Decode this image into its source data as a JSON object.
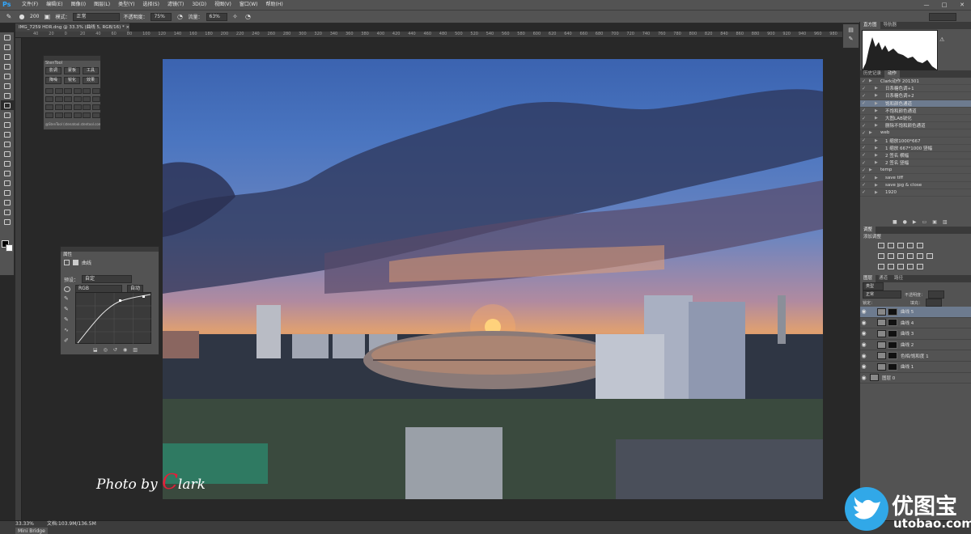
{
  "app": {
    "logo": "Ps"
  },
  "menubar": {
    "items": [
      "文件(F)",
      "编辑(E)",
      "图像(I)",
      "图层(L)",
      "类型(Y)",
      "选择(S)",
      "滤镜(T)",
      "3D(D)",
      "视图(V)",
      "窗口(W)",
      "帮助(H)"
    ],
    "window_controls": [
      "—",
      "□",
      "✕"
    ]
  },
  "options_bar": {
    "brush_size": "200",
    "mode_label": "模式：",
    "mode_value": "正常",
    "opacity_label": "不透明度：",
    "opacity_value": "75%",
    "flow_label": "流量：",
    "flow_value": "63%"
  },
  "document": {
    "tab_title": "IMG_7259 HDR.dng @ 33.3% (曲线 5, RGB/16) * ×",
    "ruler_ticks": [
      "40",
      "20",
      "0",
      "20",
      "40",
      "60",
      "80",
      "100",
      "120",
      "140",
      "160",
      "180",
      "200",
      "220",
      "240",
      "260",
      "280",
      "300",
      "320",
      "340",
      "360",
      "380",
      "400",
      "420",
      "440",
      "460",
      "480",
      "500",
      "520",
      "540",
      "560",
      "580",
      "600",
      "620",
      "640",
      "660",
      "680",
      "700",
      "720",
      "740",
      "760",
      "780",
      "800",
      "820",
      "840",
      "860",
      "880",
      "900",
      "920",
      "940",
      "960",
      "980",
      "1000"
    ]
  },
  "watermark": {
    "prefix": "Photo by ",
    "initial": "C",
    "rest": "lark"
  },
  "stn_panel": {
    "title": "StenTool",
    "buttons": [
      "影调",
      "蒙板",
      "工具",
      "降噪",
      "锐化",
      "效果"
    ],
    "footer": "@StenTool (stenatool.stentool.com)"
  },
  "properties_panel": {
    "tab": "属性",
    "title": "曲线",
    "preset_label": "预设：",
    "preset_value": "自定",
    "channel_value": "RGB",
    "auto_label": "自动"
  },
  "histogram_panel": {
    "tabs": [
      "直方图",
      "导航器"
    ]
  },
  "actions_panel": {
    "tabs": [
      "历史记录",
      "动作"
    ],
    "rows": [
      {
        "label": "Clark动作 201301",
        "selected": false
      },
      {
        "label": "日系糖色调+1",
        "selected": false
      },
      {
        "label": "日系糖色调+2",
        "selected": false
      },
      {
        "label": "饱和颜色通道",
        "selected": true
      },
      {
        "label": "不饱和颜色通道",
        "selected": false
      },
      {
        "label": "大图LAB锐化",
        "selected": false
      },
      {
        "label": "删除不饱和颜色通道",
        "selected": false
      },
      {
        "label": "web",
        "selected": false
      },
      {
        "label": "1 缩放1000*667",
        "selected": false
      },
      {
        "label": "1 缩放 667*1000 竖幅",
        "selected": false
      },
      {
        "label": "2 签名 横幅",
        "selected": false
      },
      {
        "label": "2 签名 竖幅",
        "selected": false
      },
      {
        "label": "temp",
        "selected": false
      },
      {
        "label": "save tiff",
        "selected": false
      },
      {
        "label": "save jpg & close",
        "selected": false
      },
      {
        "label": "1920",
        "selected": false
      }
    ]
  },
  "adjustments_panel": {
    "tabs": [
      "调整"
    ],
    "hint": "添加调整"
  },
  "layers_panel": {
    "tabs": [
      "图层",
      "通道",
      "路径"
    ],
    "kind_label": "类型",
    "blend_mode": "正常",
    "opacity_label": "不透明度：",
    "lock_label": "锁定：",
    "fill_label": "填充：",
    "layers": [
      {
        "name": "曲线 5",
        "selected": true,
        "is_background": false
      },
      {
        "name": "曲线 4",
        "selected": false,
        "is_background": false
      },
      {
        "name": "曲线 3",
        "selected": false,
        "is_background": false
      },
      {
        "name": "曲线 2",
        "selected": false,
        "is_background": false
      },
      {
        "name": "色相/饱和度 1",
        "selected": false,
        "is_background": false
      },
      {
        "name": "曲线 1",
        "selected": false,
        "is_background": false
      },
      {
        "name": "图层 0",
        "selected": false,
        "is_background": true
      }
    ]
  },
  "status_bar": {
    "zoom": "33.33%",
    "doc_info": "文档:103.9M/136.5M",
    "bridge_tab": "Mini Bridge"
  },
  "brand": {
    "cn": "优图宝",
    "url": "utobao.com"
  },
  "colors": {
    "accent": "#31a8ff",
    "panel_bg": "#535353",
    "canvas_bg": "#282828",
    "selection": "#6d7b8f"
  }
}
